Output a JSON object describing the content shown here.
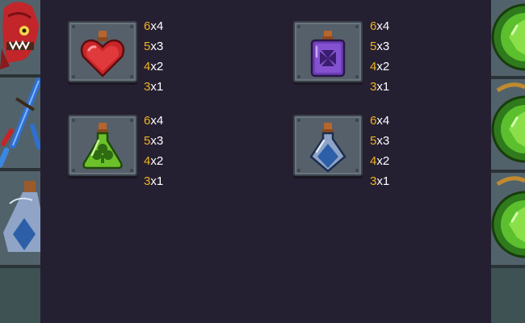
{
  "paytable": {
    "symbols": [
      {
        "name": "red-heart-potion",
        "icon": "red-heart-potion-icon",
        "color": "#d42a2a",
        "pays": [
          {
            "count": "6",
            "sep": "x",
            "value": "4"
          },
          {
            "count": "5",
            "sep": "x",
            "value": "3"
          },
          {
            "count": "4",
            "sep": "x",
            "value": "2"
          },
          {
            "count": "3",
            "sep": "x",
            "value": "1"
          }
        ]
      },
      {
        "name": "purple-cross-potion",
        "icon": "purple-cross-potion-icon",
        "color": "#6b3fb5",
        "pays": [
          {
            "count": "6",
            "sep": "x",
            "value": "4"
          },
          {
            "count": "5",
            "sep": "x",
            "value": "3"
          },
          {
            "count": "4",
            "sep": "x",
            "value": "2"
          },
          {
            "count": "3",
            "sep": "x",
            "value": "1"
          }
        ]
      },
      {
        "name": "green-club-potion",
        "icon": "green-club-potion-icon",
        "color": "#6cc12a",
        "pays": [
          {
            "count": "6",
            "sep": "x",
            "value": "4"
          },
          {
            "count": "5",
            "sep": "x",
            "value": "3"
          },
          {
            "count": "4",
            "sep": "x",
            "value": "2"
          },
          {
            "count": "3",
            "sep": "x",
            "value": "1"
          }
        ]
      },
      {
        "name": "blue-diamond-potion",
        "icon": "blue-diamond-potion-icon",
        "color": "#3d6cb0",
        "pays": [
          {
            "count": "6",
            "sep": "x",
            "value": "4"
          },
          {
            "count": "5",
            "sep": "x",
            "value": "3"
          },
          {
            "count": "4",
            "sep": "x",
            "value": "2"
          },
          {
            "count": "3",
            "sep": "x",
            "value": "1"
          }
        ]
      }
    ]
  },
  "reels": {
    "left_icons": [
      "red-monster-icon",
      "blue-sword-icon",
      "blue-diamond-potion-icon"
    ],
    "right_icons": [
      "green-gem-amulet-icon",
      "green-gem-amulet-icon",
      "green-gem-amulet-icon"
    ]
  },
  "colors": {
    "background": "#241e31",
    "count": "#f0b31c",
    "value": "#ffffff"
  }
}
